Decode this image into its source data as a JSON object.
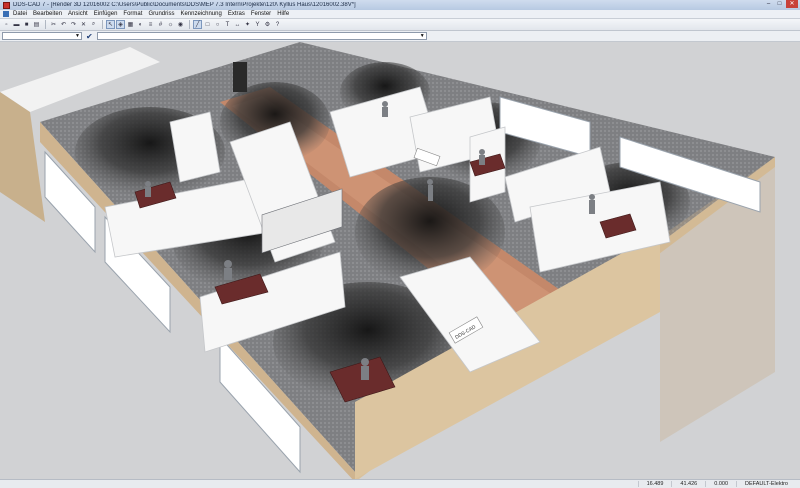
{
  "window": {
    "title": "DDS-CAD 7 - [Render 3D  12016002  C:\\Users\\Public\\Documents\\DDS\\MEP 7.3 Intern\\Projekte\\120\\ Kyllus Haus\\12016002.38V*]",
    "controls": [
      "–",
      "□",
      "✕"
    ]
  },
  "menu": {
    "items": [
      "Datei",
      "Bearbeiten",
      "Ansicht",
      "Einfügen",
      "Format",
      "Grundriss",
      "Kennzeichnung",
      "Extras",
      "Fenster",
      "Hilfe"
    ]
  },
  "option_bar": {
    "check_symbol": "✔"
  },
  "status": {
    "x": "16.489",
    "y": "41.426",
    "z": "0.000",
    "layer": "DEFAULT-Elektro"
  },
  "signage": {
    "logo_text": "DDS-CAD"
  }
}
